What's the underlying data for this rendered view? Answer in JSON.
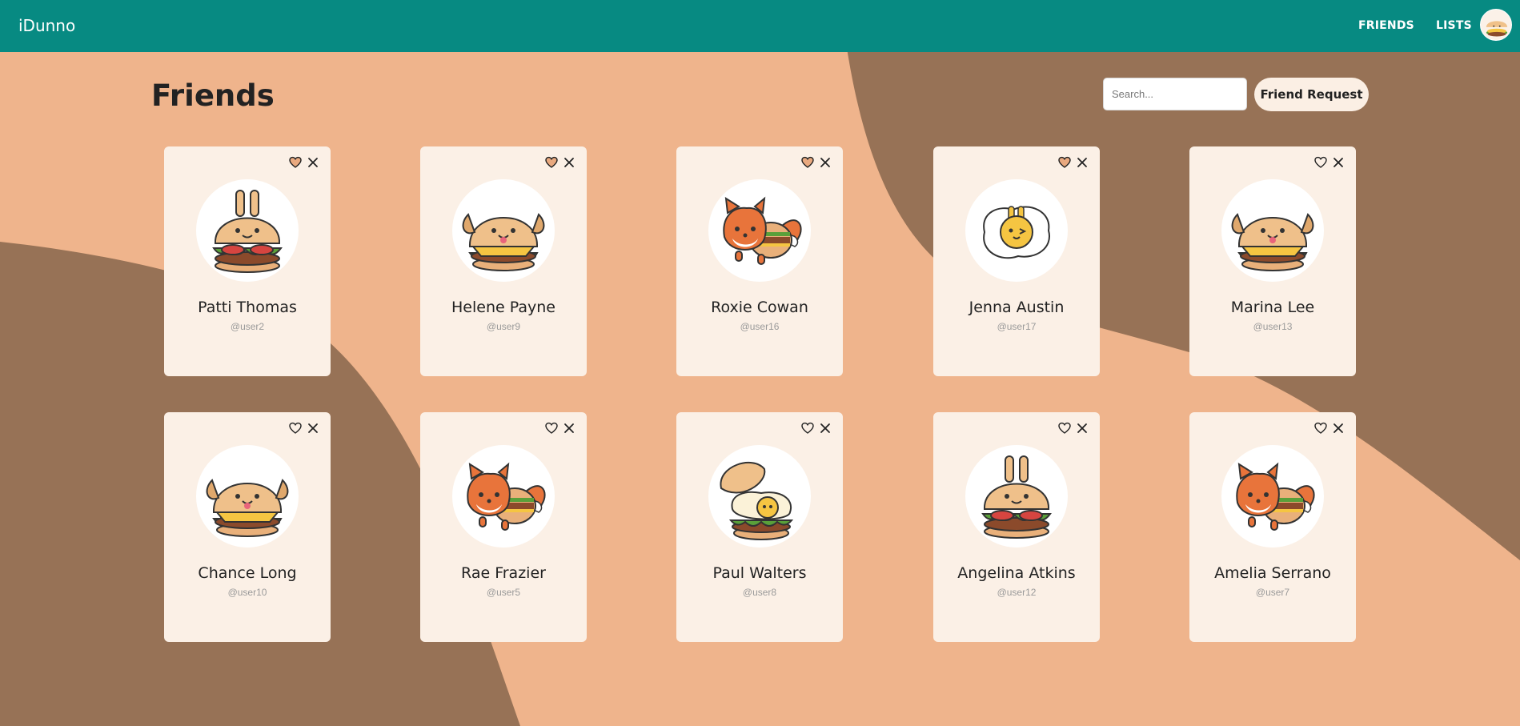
{
  "app": {
    "brand": "iDunno"
  },
  "nav": {
    "friends": "FRIENDS",
    "lists": "LISTS"
  },
  "page": {
    "title": "Friends"
  },
  "search": {
    "placeholder": "Search..."
  },
  "actions": {
    "friend_request": "Friend Request"
  },
  "colors": {
    "navbar": "#078a82",
    "background_light": "#efb48c",
    "background_dark": "#977256",
    "card": "#fbf0e6",
    "heart_filled": "#e9a97f"
  },
  "friends": [
    {
      "name": "Patti Thomas",
      "handle": "@user2",
      "avatar": "bunny-burger-icon",
      "favorite": true
    },
    {
      "name": "Helene Payne",
      "handle": "@user9",
      "avatar": "puppy-burger-icon",
      "favorite": true
    },
    {
      "name": "Roxie Cowan",
      "handle": "@user16",
      "avatar": "fox-burger-icon",
      "favorite": true
    },
    {
      "name": "Jenna Austin",
      "handle": "@user17",
      "avatar": "bunny-egg-icon",
      "favorite": true
    },
    {
      "name": "Marina Lee",
      "handle": "@user13",
      "avatar": "puppy-burger-icon",
      "favorite": false
    },
    {
      "name": "Chance Long",
      "handle": "@user10",
      "avatar": "puppy-burger-icon",
      "favorite": false
    },
    {
      "name": "Rae Frazier",
      "handle": "@user5",
      "avatar": "fox-burger-icon",
      "favorite": false
    },
    {
      "name": "Paul Walters",
      "handle": "@user8",
      "avatar": "egg-burger-icon",
      "favorite": false
    },
    {
      "name": "Angelina Atkins",
      "handle": "@user12",
      "avatar": "bunny-burger-icon",
      "favorite": false
    },
    {
      "name": "Amelia Serrano",
      "handle": "@user7",
      "avatar": "fox-burger-icon",
      "favorite": false
    }
  ]
}
